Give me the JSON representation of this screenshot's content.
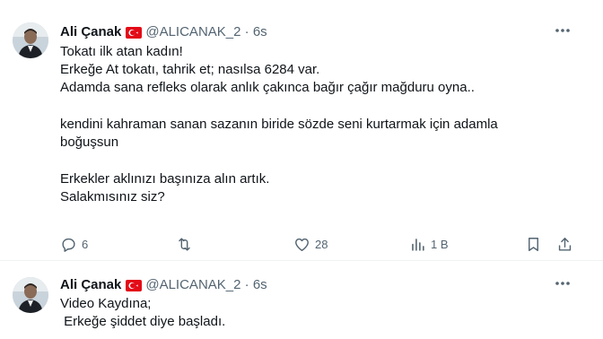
{
  "tweets": [
    {
      "author": {
        "name": "Ali Çanak",
        "handle": "@ALICANAK_2",
        "separator": "·",
        "time": "6s",
        "flag_icon": "turkey-flag-icon"
      },
      "lines": [
        "Tokatı ilk atan kadın!",
        "Erkeğe At tokatı, tahrik et;  nasılsa 6284 var.",
        "Adamda sana refleks olarak anlık çakınca bağır çağır mağduru oyna..",
        "",
        "kendini kahraman sanan sazanın biride sözde seni kurtarmak için adamla",
        "boğuşsun",
        "",
        "Erkekler aklınızı başınıza alın artık.",
        "Salakmısınız siz?"
      ],
      "actions": {
        "reply_count": "6",
        "retweet_count": "",
        "like_count": "28",
        "views_count": "1 B"
      }
    },
    {
      "author": {
        "name": "Ali Çanak",
        "handle": "@ALICANAK_2",
        "separator": "·",
        "time": "6s",
        "flag_icon": "turkey-flag-icon"
      },
      "lines": [
        "Video Kaydına;",
        " Erkeğe şiddet diye başladı."
      ]
    }
  ],
  "colors": {
    "text": "#0f1419",
    "secondary": "#536471",
    "flag_red": "#e30a17",
    "divider": "#eff3f4"
  }
}
